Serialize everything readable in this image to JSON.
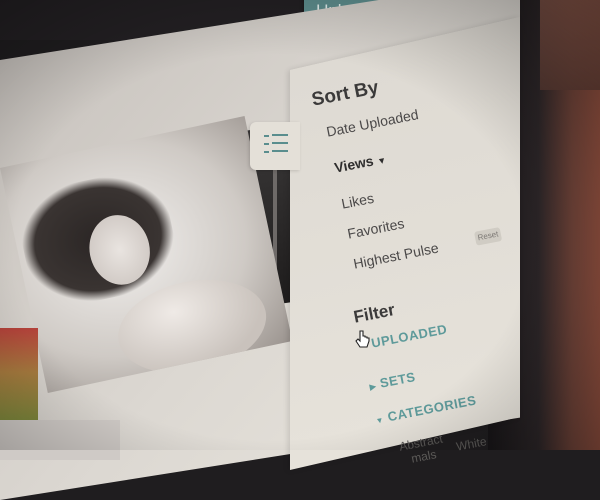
{
  "header": {
    "upload_label": "Upload"
  },
  "sort": {
    "heading": "Sort By",
    "options": [
      "Date Uploaded",
      "Views",
      "Likes",
      "Favorites",
      "Highest Pulse"
    ],
    "selected_marker": "▼"
  },
  "filter": {
    "heading": "Filter",
    "reset_label": "Reset",
    "items": [
      "UPLOADED",
      "SETS",
      "CATEGORIES"
    ],
    "sub_items": [
      "Abstract",
      "mals",
      "White"
    ]
  },
  "colors": {
    "accent": "#5e9a9a",
    "upload_bg": "#5e8e8e",
    "panel_bg": "#e2ded6"
  },
  "icons": {
    "filter_toggle": "filter-list-icon",
    "cursor": "hand-pointer-icon"
  }
}
